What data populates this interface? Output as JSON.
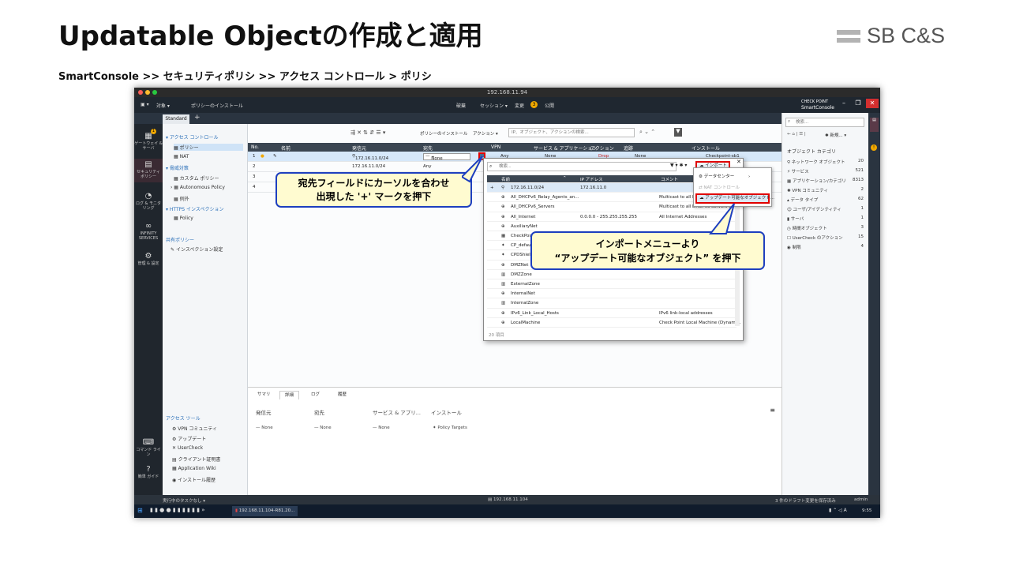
{
  "slide": {
    "title": "Updatable Objectの作成と適用",
    "brand": "SB C&S",
    "breadcrumb": "SmartConsole >> セキュリティポリシ >> アクセス コントロール > ポリシ"
  },
  "app": {
    "window_title": "192.168.11.94",
    "toolbar": {
      "objects_menu": "対象 ▾",
      "install_policy": "ポリシーのインストール",
      "discard": "破棄",
      "session": "セッション ▾",
      "changes": "変更",
      "changes_count": "3",
      "publish": "公開",
      "brand_line1": "CHECK POINT",
      "brand_line2": "SmartConsole"
    },
    "tab": "Standard",
    "left_rail": [
      {
        "label": "ゲートウェイ & サーバ",
        "icon": "gateways-icon"
      },
      {
        "label": "セキュリティ ポリシー",
        "icon": "security-policies-icon"
      },
      {
        "label": "ログ & モニタリング",
        "icon": "logs-icon"
      },
      {
        "label": "INFINITY SERVICES",
        "icon": "infinity-icon"
      },
      {
        "label": "管理 & 設定",
        "icon": "manage-icon"
      },
      {
        "label": "コマンド ライン",
        "icon": "command-line-icon"
      },
      {
        "label": "簡単 ガイド",
        "icon": "help-icon"
      }
    ],
    "gateways_badge": "1",
    "nav": {
      "access_control": "アクセス コントロール",
      "policy": "ポリシー",
      "nat": "NAT",
      "threat_prevention": "脅威対策",
      "custom_policy": "カスタム ポリシー",
      "autonomous_policy": "Autonomous Policy",
      "exceptions": "例外",
      "https_inspection": "HTTPS インスペクション",
      "https_policy": "Policy",
      "shared_policies": "共有ポリシー",
      "inspection_settings": "インスペクション設定",
      "access_tools": "アクセス ツール",
      "tools": [
        "VPN コミュニティ",
        "アップデート",
        "UserCheck",
        "クライアント証明書",
        "Application Wiki",
        "インストール履歴"
      ]
    },
    "grid_toolbar": {
      "install_policy": "ポリシーのインストール",
      "actions": "アクション ▾",
      "search_placeholder": "IP、オブジェクト、アクションの検索..."
    },
    "columns": [
      "No.",
      "名前",
      "発信元",
      "宛先",
      "VPN",
      "サービス & アプリケーション",
      "アクション",
      "追跡",
      "インストール"
    ],
    "rows": [
      {
        "no": "1",
        "src": "172.16.11.0/24",
        "dst": "None",
        "vpn": "Any",
        "svc": "None",
        "action": "Drop",
        "track": "None",
        "install": "Checkpoint-sb1"
      },
      {
        "no": "2",
        "src": "172.16.11.0/24",
        "dst": "Any",
        "vpn": "",
        "svc": "",
        "action": "",
        "track": "",
        "install": ""
      },
      {
        "no": "3",
        "src": "",
        "dst": "",
        "vpn": "",
        "svc": "",
        "action": "",
        "track": "",
        "install": ""
      },
      {
        "no": "4",
        "src": "",
        "dst": "",
        "vpn": "",
        "svc": "",
        "action": "",
        "track": "",
        "install": ""
      }
    ],
    "bottom_tabs": [
      "サマリ",
      "詳細",
      "ログ",
      "履歴"
    ],
    "bottom_cols": [
      {
        "title": "発信元",
        "value": "None"
      },
      {
        "title": "宛先",
        "value": "None"
      },
      {
        "title": "サービス & アプリ...",
        "value": "None"
      },
      {
        "title": "インストール",
        "value": "Policy Targets"
      }
    ],
    "status": {
      "left": "実行中のタスクなし ▾",
      "center": "192.168.11.104",
      "right": "3 件のドラフト変更を保存済み",
      "user": "admin"
    },
    "taskbar": {
      "item": "192.168.11.104-R81.20...",
      "time": "9:55"
    },
    "right_panel": {
      "search_placeholder": "検索...",
      "new_button": "新規...",
      "title": "オブジェクト カテゴリ",
      "categories": [
        {
          "label": "ネットワーク オブジェクト",
          "count": "20"
        },
        {
          "label": "サービス",
          "count": "521"
        },
        {
          "label": "アプリケーション/カテゴリ",
          "count": "8313"
        },
        {
          "label": "VPN コミュニティ",
          "count": "2"
        },
        {
          "label": "データ タイプ",
          "count": "62"
        },
        {
          "label": "ユーザ/アイデンティティ",
          "count": "1"
        },
        {
          "label": "サーバ",
          "count": "1"
        },
        {
          "label": "時間オブジェクト",
          "count": "3"
        },
        {
          "label": "UserCheck のアクション",
          "count": "15"
        },
        {
          "label": "制限",
          "count": "4"
        }
      ]
    },
    "picker": {
      "search_placeholder": "検索...",
      "import_button": "インポート ▾",
      "columns": [
        "名前",
        "IP アドレス",
        "コメント"
      ],
      "rows": [
        {
          "name": "172.16.11.0/24",
          "ip": "172.16.11.0",
          "comment": ""
        },
        {
          "name": "All_DHCPv6_Relay_Agents_an...",
          "ip": "",
          "comment": "Multicast to all DHCPv6 relay"
        },
        {
          "name": "All_DHCPv6_Servers",
          "ip": "",
          "comment": "Multicast to all DHCPv6 servers on"
        },
        {
          "name": "All_Internet",
          "ip": "0.0.0.0 - 255.255.255.255",
          "comment": "All Internet Addresses"
        },
        {
          "name": "AuxiliaryNet",
          "ip": "",
          "comment": ""
        },
        {
          "name": "CheckPoint",
          "ip": "",
          "comment": ""
        },
        {
          "name": "CP_default",
          "ip": "",
          "comment": ""
        },
        {
          "name": "CPDShield",
          "ip": "",
          "comment": ""
        },
        {
          "name": "DMZNet",
          "ip": "",
          "comment": ""
        },
        {
          "name": "DMZZone",
          "ip": "",
          "comment": ""
        },
        {
          "name": "ExternalZone",
          "ip": "",
          "comment": ""
        },
        {
          "name": "InternalNet",
          "ip": "",
          "comment": ""
        },
        {
          "name": "InternalZone",
          "ip": "",
          "comment": ""
        },
        {
          "name": "IPv6_Link_Local_Hosts",
          "ip": "",
          "comment": "IPv6 link-local addresses"
        },
        {
          "name": "LocalMachine",
          "ip": "",
          "comment": "Check Point Local Machine (Dynami..."
        }
      ],
      "footer": "20 項目"
    },
    "import_menu": {
      "data_center": "データセンター",
      "nat_control": "NAT コントロール",
      "updatable": "アップデート可能なオブジェクト..."
    }
  },
  "callouts": {
    "first": [
      "宛先フィールドにカーソルを合わせ",
      "出現した '+' マークを押下"
    ],
    "second": [
      "インポートメニューより",
      "“アップデート可能なオブジェクト” を押下"
    ]
  },
  "colors": {
    "highlight_red": "#e00000",
    "callout_border": "#1e3fbf",
    "callout_fill": "#fffbd0"
  }
}
